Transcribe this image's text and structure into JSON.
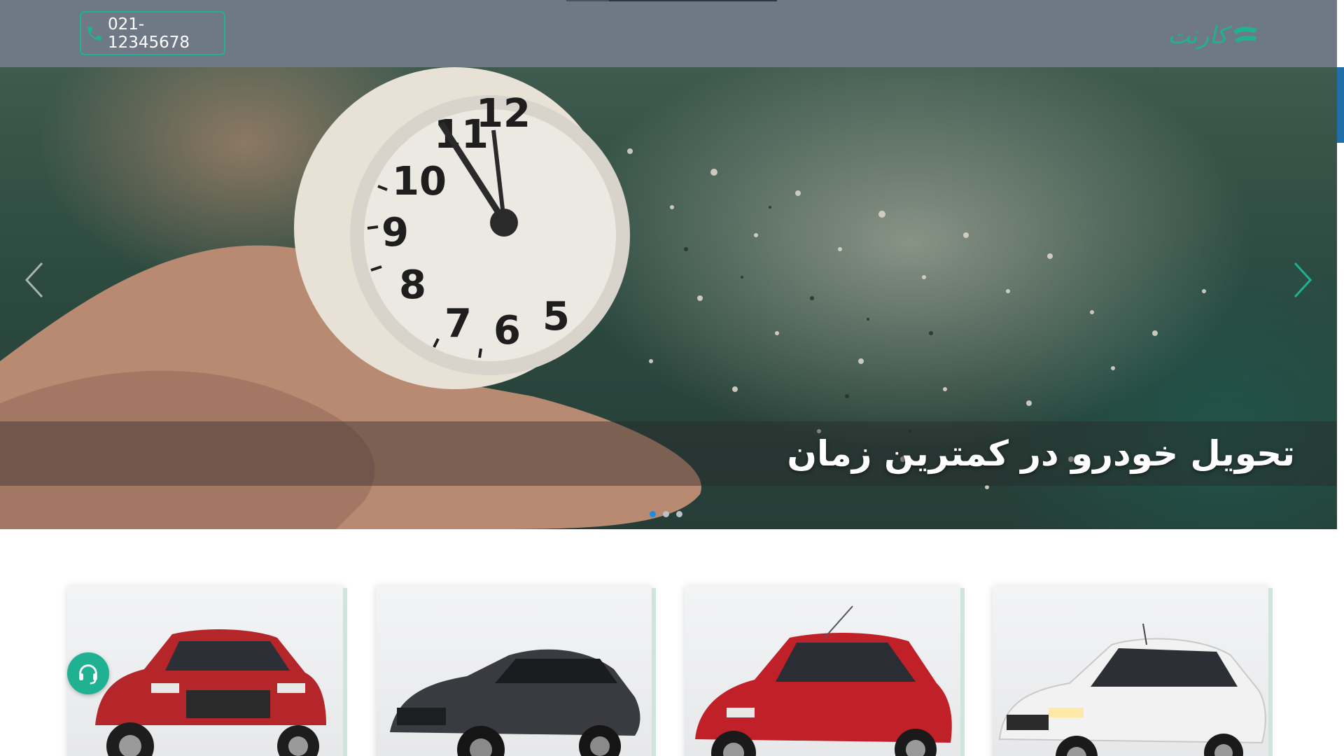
{
  "header": {
    "phone_number": "021-12345678",
    "brand_name": "کارنت",
    "phone_icon": "phone-icon",
    "logo_icon": "brand-logo-icon"
  },
  "hero": {
    "caption": "تحویل خودرو در کمترین زمان",
    "prev_icon": "chevron-left-icon",
    "next_icon": "chevron-right-icon",
    "slide_count": 3,
    "active_slide": 1
  },
  "cards": [
    {
      "car_color": "#b5262b"
    },
    {
      "car_color": "#3a3b40"
    },
    {
      "car_color": "#c02028"
    },
    {
      "car_color": "#f2f2f2"
    }
  ],
  "support": {
    "icon": "headset-icon"
  },
  "colors": {
    "header_bg": "#6f7986",
    "accent_green": "#1fb192",
    "active_dot": "#1e8de0"
  }
}
